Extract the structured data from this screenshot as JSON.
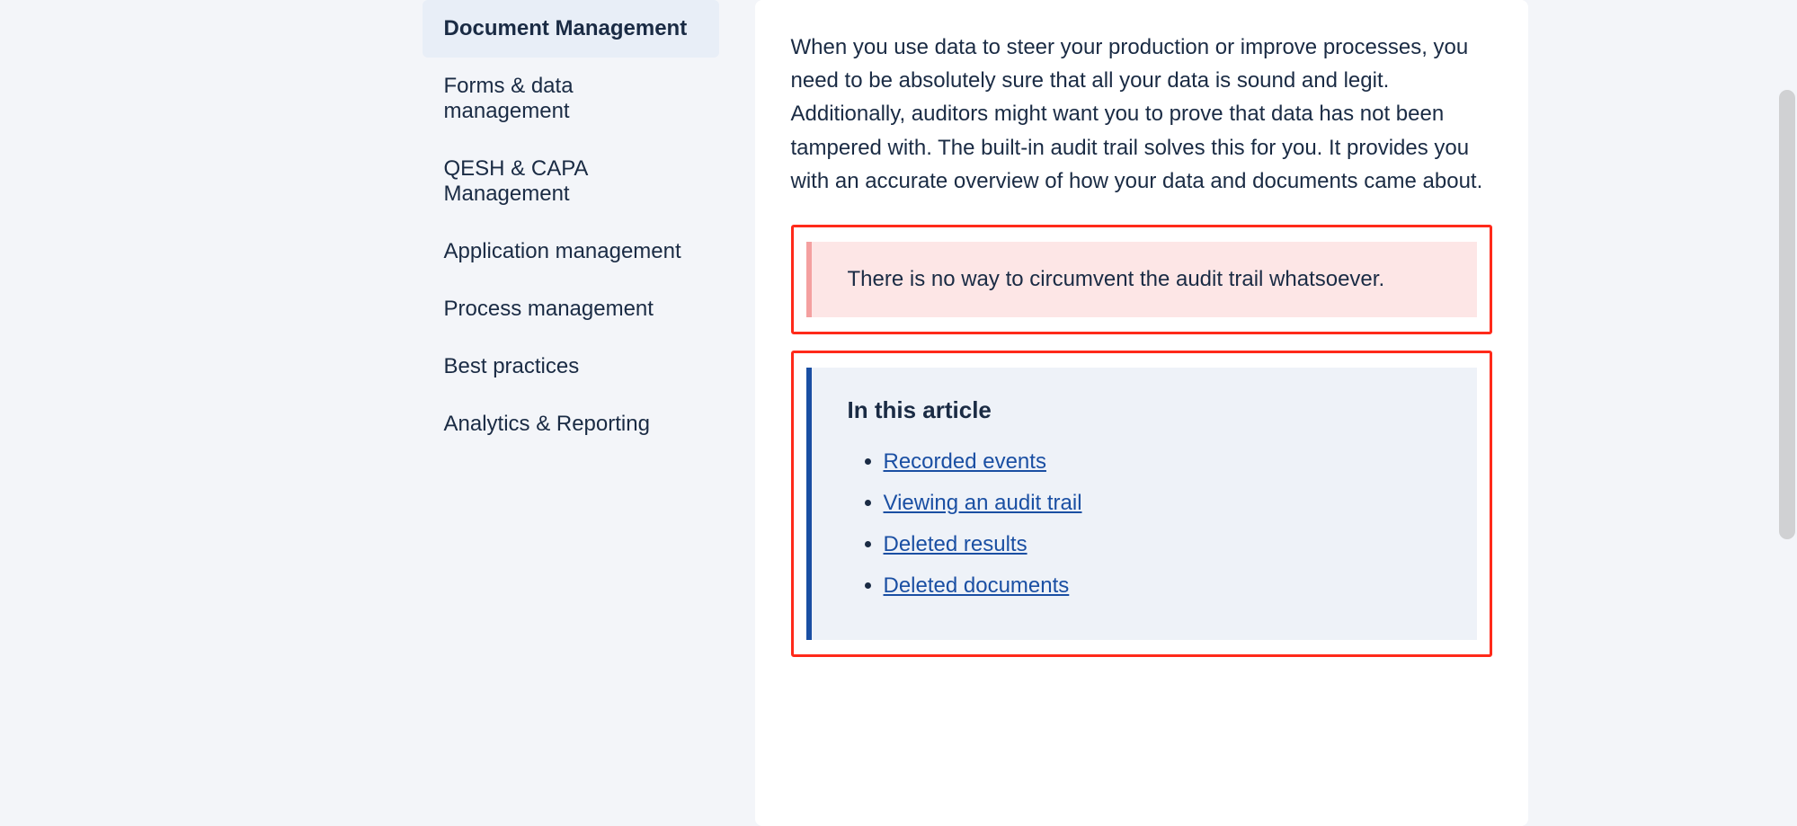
{
  "sidebar": {
    "items": [
      {
        "label": "Document Management",
        "active": true
      },
      {
        "label": "Forms & data management",
        "active": false
      },
      {
        "label": "QESH & CAPA Management",
        "active": false
      },
      {
        "label": "Application management",
        "active": false
      },
      {
        "label": "Process management",
        "active": false
      },
      {
        "label": "Best practices",
        "active": false
      },
      {
        "label": "Analytics & Reporting",
        "active": false
      }
    ]
  },
  "article": {
    "intro_paragraph": "When you use data to steer your production or improve processes, you need to be absolutely sure that all your data is sound and legit. Additionally, auditors might want you to prove that data has not been tampered with. The built-in audit trail solves this for you. It provides you with an accurate overview of how your data and documents came about.",
    "warning_text": "There is no way to circumvent the audit trail whatsoever.",
    "toc_title": "In this article",
    "toc_items": [
      "Recorded events",
      "Viewing an audit trail",
      "Deleted results",
      "Deleted documents"
    ]
  }
}
